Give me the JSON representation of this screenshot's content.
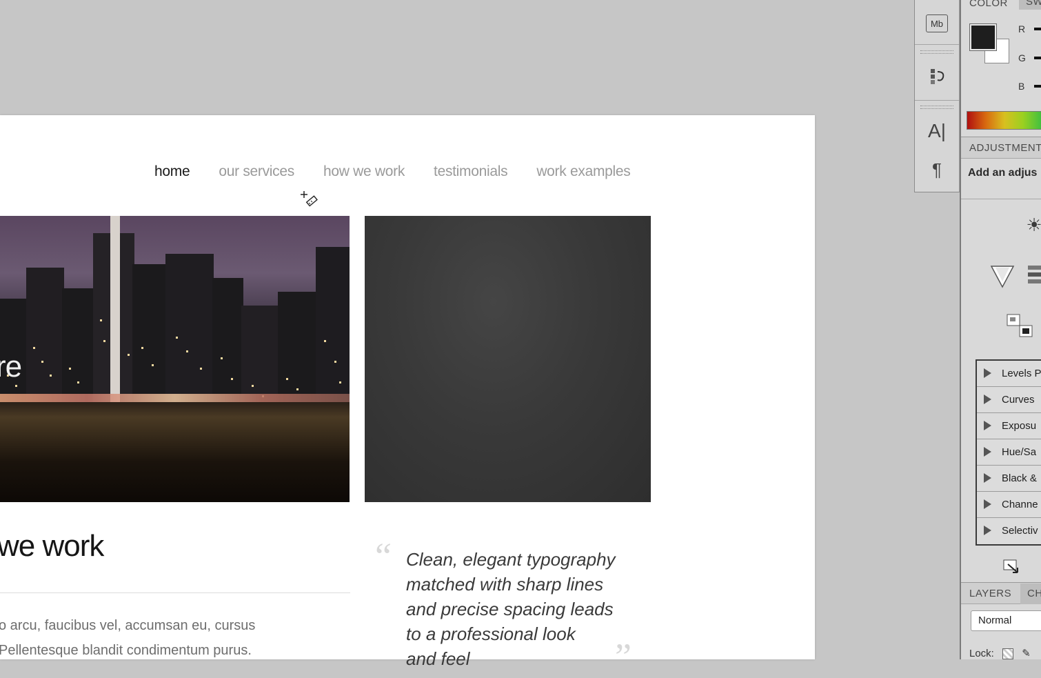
{
  "nav": {
    "items": [
      "home",
      "our services",
      "how we work",
      "testimonials",
      "work examples"
    ],
    "active": "home"
  },
  "hero": {
    "overlay_text": "re"
  },
  "section": {
    "title": "we work",
    "body_lines": [
      "o arcu, faucibus vel, accumsan eu, cursus",
      "Pellentesque blandit condimentum purus."
    ]
  },
  "testimonial": {
    "open_mark": "“",
    "close_mark": "”",
    "lines": [
      "Clean, elegant typography",
      "matched with sharp lines",
      "and precise spacing leads",
      "to a professional look",
      "and feel"
    ]
  },
  "toolstrip": {
    "icons": [
      "mini-bridge-icon",
      "history-icon",
      "character-icon",
      "paragraph-icon"
    ],
    "mb_label": "Mb"
  },
  "panel": {
    "color_tab": "COLOR",
    "color_tab2": "SW",
    "rgb_labels": [
      "R",
      "G",
      "B"
    ],
    "adjustments_tab": "ADJUSTMENT",
    "adjustments_hint": "Add an adjus",
    "presets": [
      "Levels P",
      "Curves",
      "Exposu",
      "Hue/Sa",
      "Black &",
      "Channe",
      "Selectiv"
    ],
    "layers_tab": "LAYERS",
    "layers_tab2": "CH",
    "blend_mode": "Normal",
    "lock_label": "Lock:"
  },
  "colors": {
    "canvas_bg": "#c6c6c6",
    "nav_active": "#1a1a1a",
    "nav_inactive": "#9a9a9a",
    "dark_panel": "#3a3a3a"
  }
}
